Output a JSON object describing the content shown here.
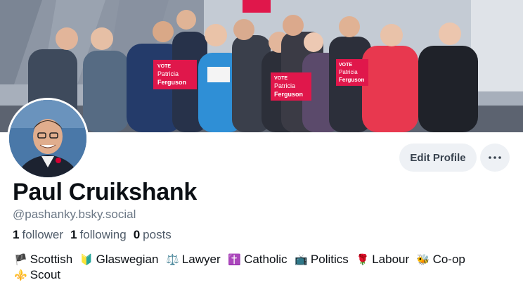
{
  "profile": {
    "display_name": "Paul Cruikshank",
    "handle": "@pashanky.bsky.social",
    "stats": {
      "followers_count": "1",
      "followers_label": "follower",
      "following_count": "1",
      "following_label": "following",
      "posts_count": "0",
      "posts_label": "posts"
    },
    "actions": {
      "edit_label": "Edit Profile",
      "more_label": "···"
    },
    "bio_tags": [
      {
        "emoji": "🏴",
        "text": "Scottish"
      },
      {
        "emoji": "🔰",
        "text": "Glaswegian"
      },
      {
        "emoji": "⚖️",
        "text": "Lawyer"
      },
      {
        "emoji": "✝️",
        "text": "Catholic"
      },
      {
        "emoji": "📺",
        "text": "Politics"
      },
      {
        "emoji": "🌹",
        "text": "Labour"
      },
      {
        "emoji": "🐝",
        "text": "Co-op"
      },
      {
        "emoji": "⚜️",
        "text": "Scout"
      }
    ],
    "banner_signs": {
      "sign_vote": "VOTE",
      "sign_name_1": "Patricia",
      "sign_name_2": "Ferguson"
    }
  },
  "colors": {
    "labour_red": "#d50032",
    "button_bg": "#eef1f5",
    "muted_text": "#6b7785"
  }
}
